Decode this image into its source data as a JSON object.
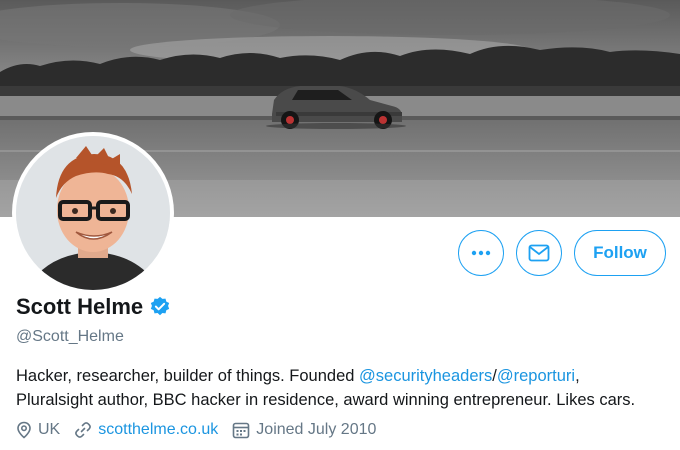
{
  "profile": {
    "name": "Scott Helme",
    "handle": "@Scott_Helme",
    "verified": true,
    "bio": {
      "text1": "Hacker, researcher, builder of things. Founded ",
      "mention1": "@securityheaders",
      "sep": "/",
      "mention2": "@reporturi",
      "text2": ",",
      "line2": "Pluralsight author, BBC hacker in residence, award winning entrepreneur. Likes cars."
    },
    "location": "UK",
    "website": "scotthelme.co.uk",
    "joined": "Joined July 2010"
  },
  "actions": {
    "more_icon": "more-icon",
    "message_icon": "envelope-icon",
    "follow_label": "Follow"
  },
  "colors": {
    "accent": "#1da1f2",
    "link": "#1b95e0",
    "secondary_text": "#657786",
    "primary_text": "#14171a"
  }
}
